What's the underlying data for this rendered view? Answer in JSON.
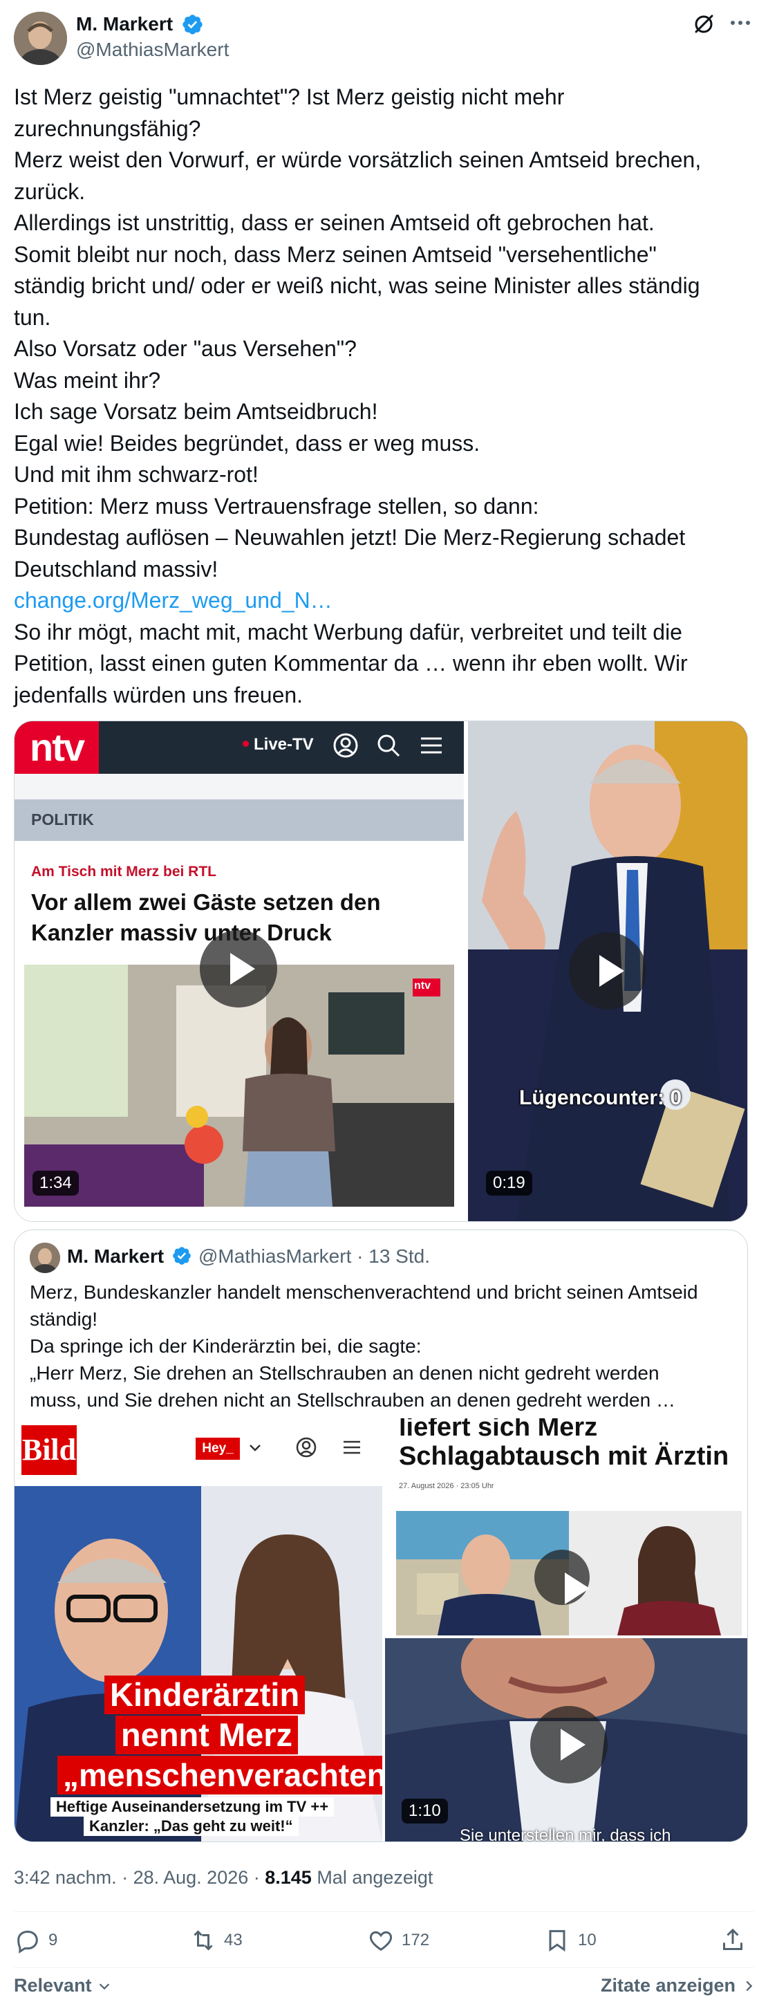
{
  "author": {
    "name": "M. Markert",
    "handle": "@MathiasMarkert"
  },
  "header_icons": [
    "grok-icon",
    "more-icon"
  ],
  "tweet": {
    "lines": [
      "Ist Merz geistig \"umnachtet\"? Ist Merz geistig nicht mehr",
      "zurechnungsfähig?",
      "Merz weist den Vorwurf, er würde vorsätzlich seinen Amtseid brechen,",
      "zurück.",
      "Allerdings ist unstrittig, dass er seinen Amtseid oft gebrochen hat.",
      "Somit bleibt nur noch, dass Merz seinen Amtseid \"versehentliche\"",
      "ständig bricht und/ oder er weiß nicht, was seine Minister alles ständig",
      "tun.",
      "Also Vorsatz oder \"aus Versehen\"?",
      "Was meint ihr?",
      "Ich sage Vorsatz beim Amtseidbruch!",
      "Egal wie! Beides begründet, dass er weg muss.",
      "Und mit ihm schwarz-rot!",
      "Petition: Merz muss Vertrauensfrage stellen, so dann:",
      "Bundestag auflösen – Neuwahlen jetzt! Die Merz-Regierung schadet",
      "Deutschland massiv!"
    ],
    "link": "change.org/Merz_weg_und_N…",
    "after_lines": [
      "So ihr mögt, macht mit, macht Werbung dafür, verbreitet und teilt die",
      "Petition, lasst einen guten Kommentar da … wenn ihr eben wollt. Wir",
      "jedenfalls würden uns freuen."
    ]
  },
  "media": {
    "left": {
      "logo": "ntv",
      "live": "Live-TV",
      "section": "POLITIK",
      "kicker": "Am Tisch mit Merz bei RTL",
      "headline_1": "Vor allem zwei Gäste setzen den",
      "headline_2": "Kanzler massiv unter Druck",
      "thumb_badge": "ntv",
      "duration": "1:34"
    },
    "right": {
      "overlay": "Lügencounter: 0",
      "duration": "0:19"
    }
  },
  "quote": {
    "name": "M. Markert",
    "handle_time": "@MathiasMarkert · 13 Std.",
    "lines": [
      "Merz, Bundeskanzler handelt menschenverachtend und bricht seinen Amtseid",
      "ständig!",
      "Da springe ich der Kinderärztin bei, die sagte:",
      "„Herr Merz, Sie drehen an Stellschrauben an denen nicht gedreht werden",
      "muss, und Sie drehen nicht an Stellschrauben an denen gedreht werden …"
    ],
    "bild": {
      "logo": "Bild",
      "hey": "Hey_",
      "head_1": "Kinderärztin",
      "head_2": "nennt Merz",
      "head_3": "„menschenverachtend“",
      "sub_1": "Heftige Auseinandersetzung im TV ++",
      "sub_2": "Kanzler: „Das geht zu weit!“"
    },
    "article": {
      "top_line": "liefert sich Merz",
      "title": "Schlagabtausch mit Ärztin",
      "date": "27. August 2026 · 23:05 Uhr"
    },
    "video2": {
      "duration": "1:10",
      "subtitle": "Sie unterstellen mir, dass ich"
    }
  },
  "meta": {
    "time": "3:42 nachm. · 28. Aug. 2026 · ",
    "views": "8.145",
    "views_label": " Mal angezeigt"
  },
  "actions": {
    "replies": "9",
    "reposts": "43",
    "likes": "172",
    "bookmarks": "10"
  },
  "footer": {
    "sort": "Relevant",
    "quotes": "Zitate anzeigen"
  },
  "colors": {
    "link": "#1d9bf0",
    "verified": "#1d9bf0",
    "muted": "#536471",
    "ntv_red": "#e4002b",
    "bild_red": "#dd0000"
  }
}
